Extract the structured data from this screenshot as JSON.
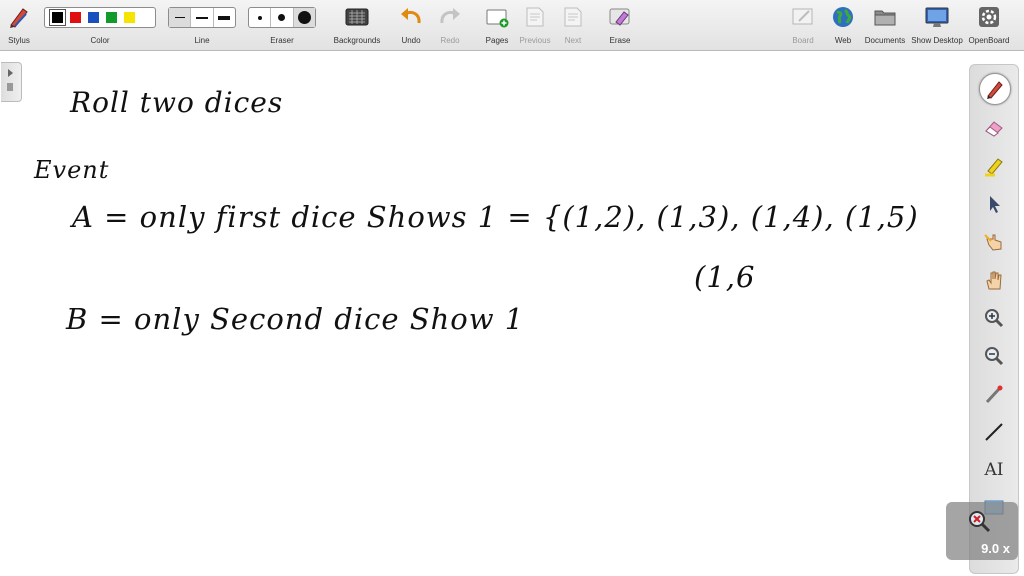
{
  "toolbar": {
    "stylus": "Stylus",
    "color": "Color",
    "line": "Line",
    "eraser": "Eraser",
    "backgrounds": "Backgrounds",
    "undo": "Undo",
    "redo": "Redo",
    "pages": "Pages",
    "previous": "Previous",
    "next": "Next",
    "erase": "Erase",
    "board": "Board",
    "web": "Web",
    "documents": "Documents",
    "show_desktop": "Show Desktop",
    "openboard": "OpenBoard"
  },
  "colors": [
    "#000000",
    "#e01010",
    "#1a4fbf",
    "#129a2a",
    "#f5e400"
  ],
  "dock": {
    "tools": [
      "pen-icon",
      "eraser-icon",
      "marker-icon",
      "selector-icon",
      "interactor-icon",
      "hand-icon",
      "zoom-in-icon",
      "zoom-out-icon",
      "laser-pointer-icon",
      "line-icon",
      "text-icon",
      "capture-icon"
    ],
    "text_tool_label": "AI"
  },
  "zoom": {
    "label": "9.0 x"
  },
  "board": {
    "line1": "Roll two dices",
    "line2": "Event",
    "line3": "A =  only  first  dice Shows 1  = {(1,2), (1,3), (1,4), (1,5)",
    "line4": "(1,6",
    "line5": "B =  only  Second  dice  Show 1"
  }
}
